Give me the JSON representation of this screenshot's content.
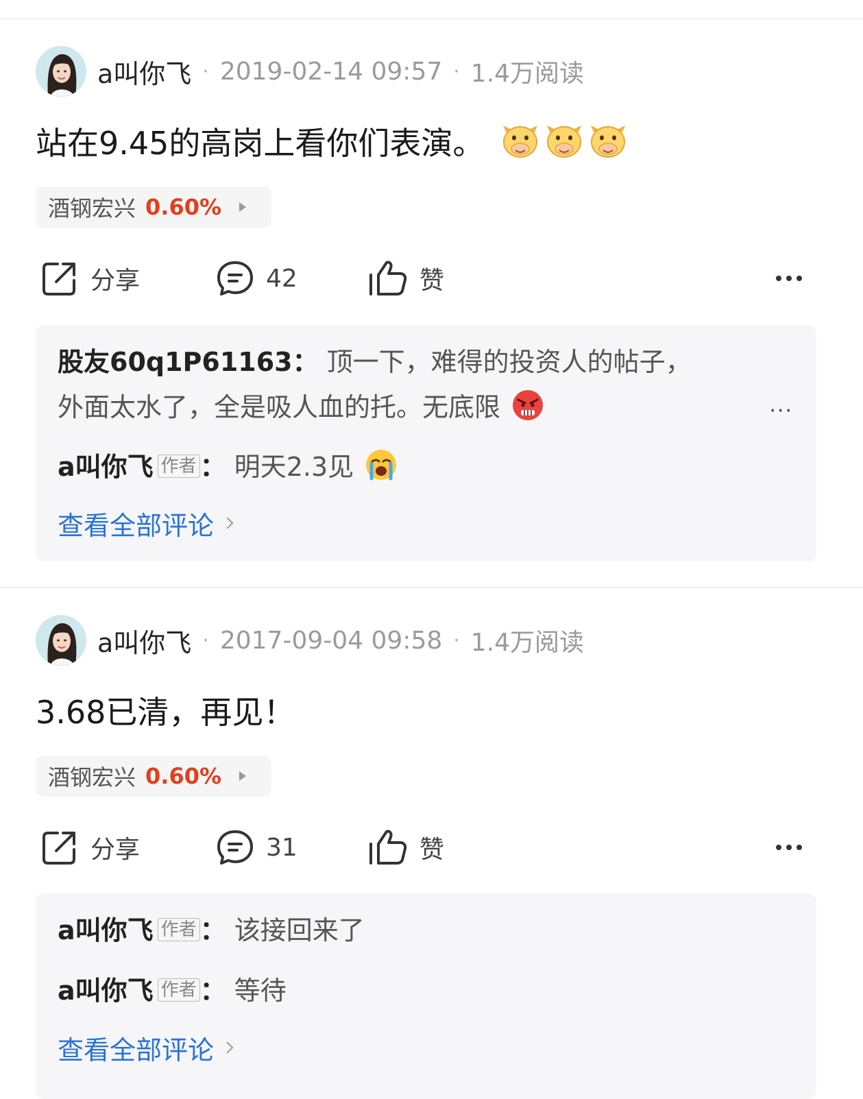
{
  "posts": [
    {
      "author": "a叫你飞",
      "separator": "·",
      "date": "2019-02-14 09:57",
      "reads": "1.4万阅读",
      "text": "站在9.45的高岗上看你们表演。",
      "emoji": "cow-face-emoji",
      "stock": {
        "name": "酒钢宏兴",
        "change": "0.60%"
      },
      "actions": {
        "share": "分享",
        "comments": "42",
        "like": "赞"
      },
      "comments": [
        {
          "user": "股友60q1P61163",
          "colon": "：",
          "line1": "顶一下，难得的投资人的帖子，",
          "line2": "外面太水了，全是吸人血的托。无底限",
          "emoji": "angry-face-emoji"
        },
        {
          "user": "a叫你飞",
          "tag": "作者",
          "colon": "：",
          "text": "明天2.3见",
          "emoji": "crying-face-emoji"
        }
      ],
      "view_all": "查看全部评论"
    },
    {
      "author": "a叫你飞",
      "separator": "·",
      "date": "2017-09-04 09:58",
      "reads": "1.4万阅读",
      "text": "3.68已清，再见！",
      "stock": {
        "name": "酒钢宏兴",
        "change": "0.60%"
      },
      "actions": {
        "share": "分享",
        "comments": "31",
        "like": "赞"
      },
      "comments": [
        {
          "user": "a叫你飞",
          "tag": "作者",
          "colon": "：",
          "text": "该接回来了"
        },
        {
          "user": "a叫你飞",
          "tag": "作者",
          "colon": "：",
          "text": "等待"
        }
      ],
      "view_all": "查看全部评论"
    }
  ],
  "colors": {
    "accent_link": "#2a73d6",
    "stock_up": "#e0401e"
  }
}
